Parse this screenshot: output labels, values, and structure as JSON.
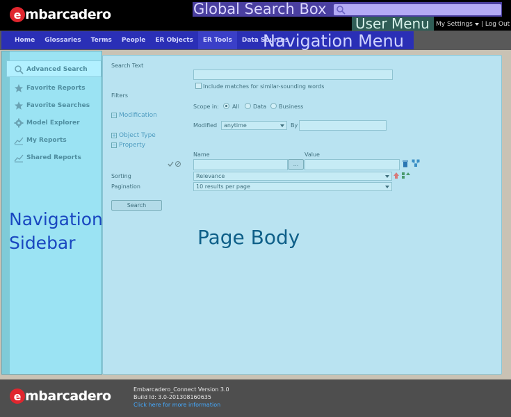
{
  "header": {
    "logo_letter": "e",
    "logo_text": "mbarcadero",
    "global_search_label": "Global Search Box",
    "user_menu_label": "User Menu",
    "my_settings": "My Settings",
    "separator": "|",
    "log_out": "Log Out"
  },
  "nav": {
    "items": [
      {
        "label": "Home"
      },
      {
        "label": "Glossaries"
      },
      {
        "label": "Terms"
      },
      {
        "label": "People"
      },
      {
        "label": "ER Objects"
      },
      {
        "label": "ER Tools"
      },
      {
        "label": "Data Sources"
      }
    ],
    "overlay_label": "Navigation Menu"
  },
  "sidebar": {
    "items": [
      {
        "label": "Advanced Search",
        "icon": "search-icon"
      },
      {
        "label": "Favorite Reports",
        "icon": "star-icon"
      },
      {
        "label": "Favorite Searches",
        "icon": "star-icon"
      },
      {
        "label": "Model Explorer",
        "icon": "gear-icon"
      },
      {
        "label": "My Reports",
        "icon": "chart-icon"
      },
      {
        "label": "Shared Reports",
        "icon": "chart-icon"
      }
    ],
    "overlay_line1": "Navigation",
    "overlay_line2": "Sidebar"
  },
  "body": {
    "search_text_label": "Search Text",
    "search_text_value": "",
    "include_similar_label": "Include matches for similar-sounding words",
    "filters_label": "Filters",
    "modification_label": "Modification",
    "object_type_label": "Object Type",
    "property_label": "Property",
    "scope_label": "Scope in:",
    "scope_options": [
      "All",
      "Data",
      "Business"
    ],
    "modified_label": "Modified",
    "modified_value": "anytime",
    "by_label": "By",
    "name_label": "Name",
    "value_label": "Value",
    "browse_label": "...",
    "sorting_label": "Sorting",
    "sorting_value": "Relevance",
    "pagination_label": "Pagination",
    "pagination_value": "10 results per page",
    "search_button": "Search",
    "overlay_label": "Page Body"
  },
  "footer": {
    "logo_letter": "e",
    "logo_text": "mbarcadero",
    "version": "Embarcadero_Connect Version 3.0",
    "build": "Build Id: 3.0-201308160635",
    "more_info": "Click here for more information"
  },
  "colors": {
    "brand_red": "#e0262e",
    "nav_highlight": "#2a2fb6",
    "sidebar_bg": "#9be3f3",
    "body_bg": "#b9e3f1",
    "link_blue": "#44aaff"
  }
}
